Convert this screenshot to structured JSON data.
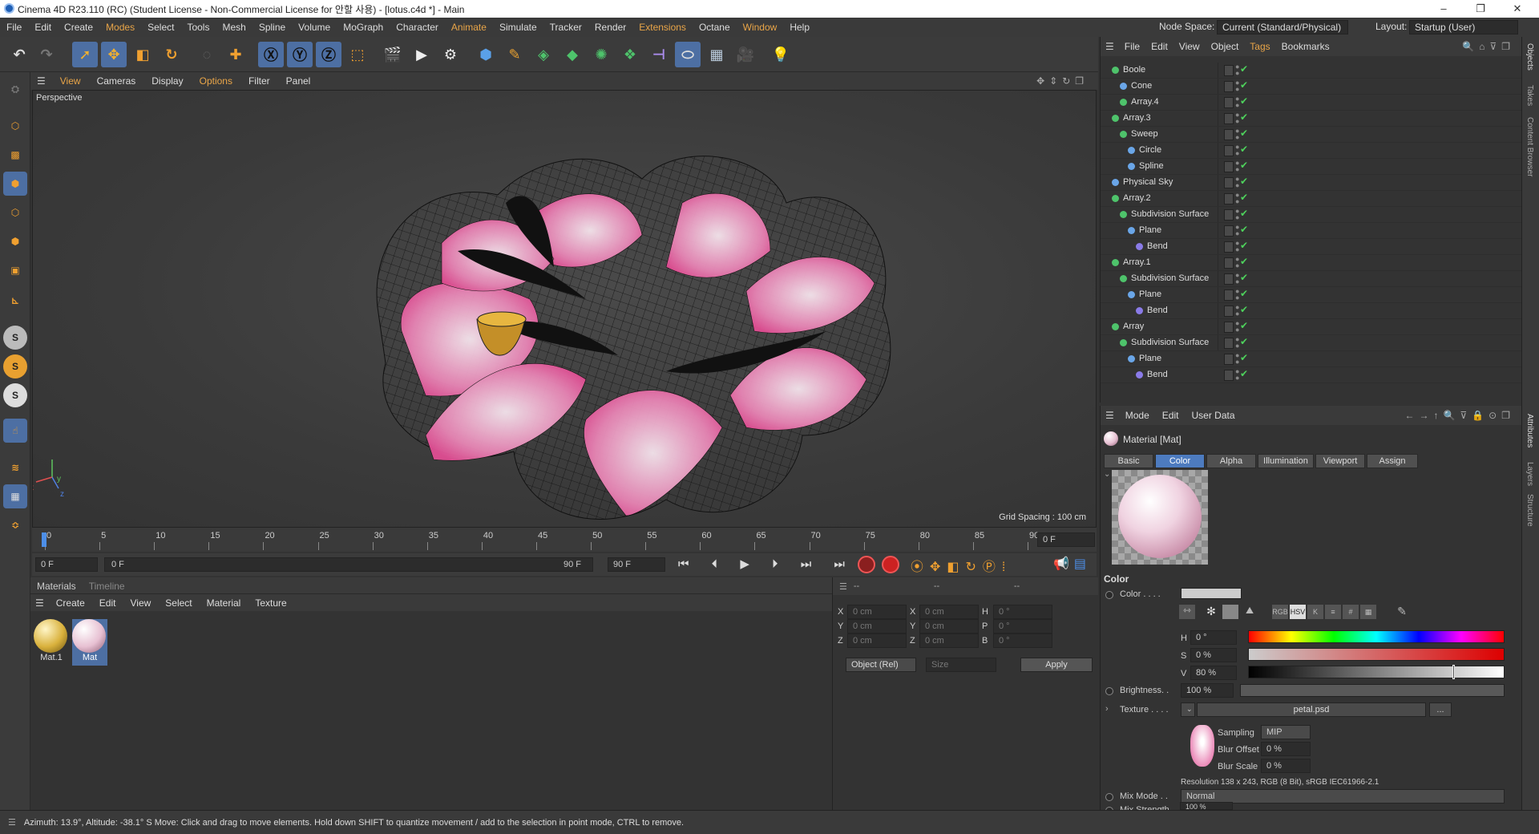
{
  "window": {
    "title": "Cinema 4D R23.110 (RC) (Student License - Non-Commercial License for 안할 사용) - [lotus.c4d *] - Main",
    "controls": [
      "–",
      "❐",
      "✕"
    ]
  },
  "menu": [
    "File",
    "Edit",
    "Create",
    "Modes",
    "Select",
    "Tools",
    "Mesh",
    "Spline",
    "Volume",
    "MoGraph",
    "Character",
    "Animate",
    "Simulate",
    "Tracker",
    "Render",
    "Extensions",
    "Octane",
    "Window",
    "Help"
  ],
  "nodespace": {
    "label": "Node Space:",
    "value": "Current (Standard/Physical)"
  },
  "layout": {
    "label": "Layout:",
    "value": "Startup (User)"
  },
  "viewport": {
    "menu": [
      "View",
      "Cameras",
      "Display",
      "Options",
      "Filter",
      "Panel"
    ],
    "camera_label": "Perspective",
    "grid_spacing": "Grid Spacing : 100 cm",
    "axis": {
      "x": "x",
      "y": "y",
      "z": "z"
    }
  },
  "timeline": {
    "ticks": [
      "0",
      "5",
      "10",
      "15",
      "20",
      "25",
      "30",
      "35",
      "40",
      "45",
      "50",
      "55",
      "60",
      "65",
      "70",
      "75",
      "80",
      "85",
      "90"
    ],
    "current_frame": "0 F"
  },
  "playbar": {
    "start": "0 F",
    "range_start": "0 F",
    "range_end": "90 F",
    "end": "90 F"
  },
  "materials": {
    "tabs": [
      "Materials",
      "Timeline"
    ],
    "menu": [
      "Create",
      "Edit",
      "View",
      "Select",
      "Material",
      "Texture"
    ],
    "items": [
      {
        "name": "Mat.1",
        "color": "#d9b13c"
      },
      {
        "name": "Mat",
        "color": "#e7c0d2"
      }
    ]
  },
  "coords": {
    "headers": [
      "--",
      "--",
      "--"
    ],
    "rows": [
      {
        "a": "X",
        "av": "0 cm",
        "b": "X",
        "bv": "0 cm",
        "c": "H",
        "cv": "0 °"
      },
      {
        "a": "Y",
        "av": "0 cm",
        "b": "Y",
        "bv": "0 cm",
        "c": "P",
        "cv": "0 °"
      },
      {
        "a": "Z",
        "av": "0 cm",
        "b": "Z",
        "bv": "0 cm",
        "c": "B",
        "cv": "0 °"
      }
    ],
    "mode": "Object (Rel)",
    "size": "Size",
    "apply": "Apply"
  },
  "objects": {
    "menu": [
      "File",
      "Edit",
      "View",
      "Object",
      "Tags",
      "Bookmarks"
    ],
    "rows": [
      {
        "name": "Boole",
        "indent": 0,
        "color": "#4ec36b"
      },
      {
        "name": "Cone",
        "indent": 1,
        "color": "#6aa6e8"
      },
      {
        "name": "Array.4",
        "indent": 1,
        "color": "#4ec36b"
      },
      {
        "name": "Array.3",
        "indent": 0,
        "color": "#4ec36b"
      },
      {
        "name": "Sweep",
        "indent": 1,
        "color": "#4ec36b"
      },
      {
        "name": "Circle",
        "indent": 2,
        "color": "#6aa6e8"
      },
      {
        "name": "Spline",
        "indent": 2,
        "color": "#6aa6e8"
      },
      {
        "name": "Physical Sky",
        "indent": 0,
        "color": "#6aa6e8"
      },
      {
        "name": "Array.2",
        "indent": 0,
        "color": "#4ec36b"
      },
      {
        "name": "Subdivision Surface",
        "indent": 1,
        "color": "#4ec36b"
      },
      {
        "name": "Plane",
        "indent": 2,
        "color": "#6aa6e8"
      },
      {
        "name": "Bend",
        "indent": 3,
        "color": "#8a7be8"
      },
      {
        "name": "Array.1",
        "indent": 0,
        "color": "#4ec36b"
      },
      {
        "name": "Subdivision Surface",
        "indent": 1,
        "color": "#4ec36b"
      },
      {
        "name": "Plane",
        "indent": 2,
        "color": "#6aa6e8"
      },
      {
        "name": "Bend",
        "indent": 3,
        "color": "#8a7be8"
      },
      {
        "name": "Array",
        "indent": 0,
        "color": "#4ec36b"
      },
      {
        "name": "Subdivision Surface",
        "indent": 1,
        "color": "#4ec36b"
      },
      {
        "name": "Plane",
        "indent": 2,
        "color": "#6aa6e8"
      },
      {
        "name": "Bend",
        "indent": 3,
        "color": "#8a7be8"
      }
    ]
  },
  "attributes": {
    "menu": [
      "Mode",
      "Edit",
      "User Data"
    ],
    "title": "Material [Mat]",
    "tabs": [
      "Basic",
      "Color",
      "Alpha",
      "Illumination",
      "Viewport",
      "Assign"
    ],
    "section": "Color",
    "color_label": "Color . . . .",
    "color_modes": [
      "RGB",
      "HSV",
      "K",
      "≡",
      "#",
      "▦"
    ],
    "h": {
      "label": "H",
      "value": "0 °"
    },
    "s": {
      "label": "S",
      "value": "0 %"
    },
    "v": {
      "label": "V",
      "value": "80 %",
      "level": 0.8
    },
    "brightness": {
      "label": "Brightness. .",
      "value": "100 %"
    },
    "texture": {
      "label": "Texture . . . .",
      "file": "petal.psd",
      "btn": "..."
    },
    "sampling": {
      "label": "Sampling",
      "value": "MIP"
    },
    "blur_offset": {
      "label": "Blur Offset",
      "value": "0 %"
    },
    "blur_scale": {
      "label": "Blur Scale",
      "value": "0 %"
    },
    "resolution": "Resolution 138 x 243, RGB (8 Bit), sRGB IEC61966-2.1",
    "mix_mode": {
      "label": "Mix Mode . .",
      "value": "Normal"
    },
    "mix_strength": {
      "label": "Mix Strength",
      "value": "100 %"
    }
  },
  "side_tabs": [
    "Objects",
    "Takes",
    "Content Browser",
    "Attributes",
    "Layers",
    "Structure"
  ],
  "status": {
    "text": "Azimuth: 13.9°, Altitude: -38.1°  S    Move: Click and drag to move elements. Hold down SHIFT to quantize movement / add to the selection in point mode, CTRL to remove."
  }
}
